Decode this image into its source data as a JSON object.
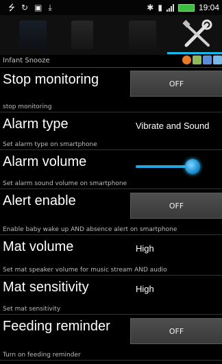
{
  "status_bar": {
    "time": "19:04",
    "left_icons": [
      "usb-icon",
      "sync-icon",
      "image-icon",
      "download-icon"
    ],
    "right_icons": [
      "bluetooth-icon",
      "vibrate-icon",
      "signal-icon",
      "battery-icon"
    ]
  },
  "toolbar": {
    "tabs": [
      "music-tab-icon",
      "document-tab-icon",
      "calendar-tab-icon",
      "settings-tools-icon"
    ],
    "selected_tab": "settings-tools-icon",
    "accent_color": "#19b8ea"
  },
  "app": {
    "name": "Infant Snooze"
  },
  "settings": {
    "stop_monitoring": {
      "title": "Stop monitoring",
      "subtitle": "stop monitoring",
      "value": "OFF"
    },
    "alarm_type": {
      "title": "Alarm type",
      "subtitle": "Set alarm type on smartphone",
      "value": "Vibrate and Sound"
    },
    "alarm_volume": {
      "title": "Alarm volume",
      "subtitle": "Set alarm sound volume on smartphone",
      "level": 0.9
    },
    "alert_enable": {
      "title": "Alert enable",
      "subtitle": "Enable baby wake up AND absence alert on smartphone",
      "value": "OFF"
    },
    "mat_volume": {
      "title": "Mat volume",
      "subtitle": "Set mat speaker volume for music stream AND audio",
      "value": "High"
    },
    "mat_sensitivity": {
      "title": "Mat sensitivity",
      "subtitle": "Set mat sensitivity",
      "value": "High"
    },
    "feeding_reminder": {
      "title": "Feeding reminder",
      "subtitle": "Turn on feeding reminder",
      "value": "OFF"
    }
  }
}
